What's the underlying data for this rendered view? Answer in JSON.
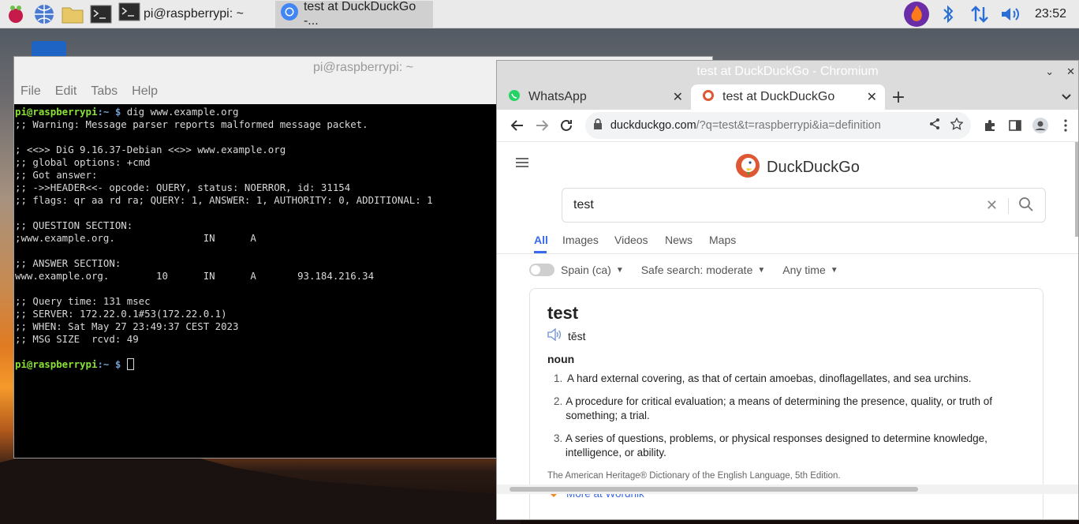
{
  "taskbar": {
    "tasks": [
      {
        "label": "pi@raspberrypi: ~"
      },
      {
        "label": "test at DuckDuckGo -..."
      }
    ],
    "clock": "23:52"
  },
  "terminal": {
    "title": "pi@raspberrypi: ~",
    "menu": [
      "File",
      "Edit",
      "Tabs",
      "Help"
    ],
    "prompt_user": "pi@raspberrypi",
    "prompt_path": ":~",
    "prompt_symbol": "$",
    "command": "dig www.example.org",
    "output": [
      ";; Warning: Message parser reports malformed message packet.",
      "",
      "; <<>> DiG 9.16.37-Debian <<>> www.example.org",
      ";; global options: +cmd",
      ";; Got answer:",
      ";; ->>HEADER<<- opcode: QUERY, status: NOERROR, id: 31154",
      ";; flags: qr aa rd ra; QUERY: 1, ANSWER: 1, AUTHORITY: 0, ADDITIONAL: 1",
      "",
      ";; QUESTION SECTION:",
      ";www.example.org.               IN      A",
      "",
      ";; ANSWER SECTION:",
      "www.example.org.        10      IN      A       93.184.216.34",
      "",
      ";; Query time: 131 msec",
      ";; SERVER: 172.22.0.1#53(172.22.0.1)",
      ";; WHEN: Sat May 27 23:49:37 CEST 2023",
      ";; MSG SIZE  rcvd: 49",
      ""
    ]
  },
  "browser": {
    "title": "test at DuckDuckGo - Chromium",
    "tabs": [
      {
        "label": "WhatsApp"
      },
      {
        "label": "test at DuckDuckGo"
      }
    ],
    "url_host": "duckduckgo.com",
    "url_path": "/?q=test&t=raspberrypi&ia=definition",
    "ddg": {
      "logo_text": "DuckDuckGo",
      "query": "test",
      "verticals": [
        "All",
        "Images",
        "Videos",
        "News",
        "Maps"
      ],
      "region": "Spain (ca)",
      "safe_search": "Safe search: moderate",
      "time": "Any time",
      "definition": {
        "word": "test",
        "pronunciation": "tĕst",
        "part_of_speech": "noun",
        "senses": [
          {
            "num": "1.",
            "text": "A hard external covering, as that of certain amoebas, dinoflagellates, and sea urchins."
          },
          {
            "num": "2.",
            "text": "A procedure for critical evaluation; a means of determining the presence, quality, or truth of something; a trial."
          },
          {
            "num": "3.",
            "text": "A series of questions, problems, or physical responses designed to determine knowledge, intelligence, or ability."
          }
        ],
        "source": "The American Heritage® Dictionary of the English Language, 5th Edition.",
        "more_link": "More at Wordnik"
      }
    }
  }
}
